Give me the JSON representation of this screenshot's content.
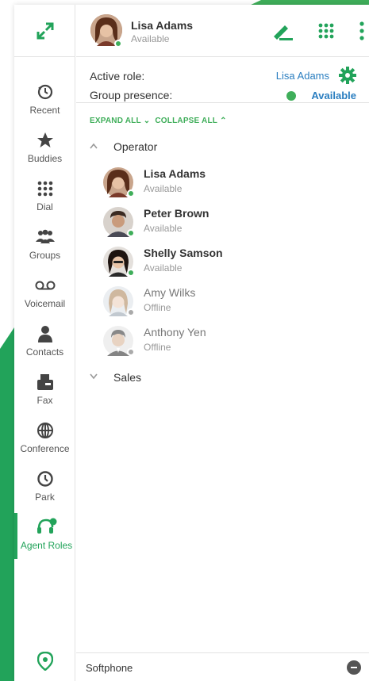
{
  "accent_color": "#22a35a",
  "header": {
    "user_name": "Lisa Adams",
    "user_status": "Available",
    "edit_icon": "pencil-icon",
    "dialpad_icon": "dialpad-icon",
    "menu_icon": "more-vertical-icon"
  },
  "sidebar": {
    "expand_icon": "expand-arrows-icon",
    "items": [
      {
        "label": "Recent",
        "icon": "history-icon"
      },
      {
        "label": "Buddies",
        "icon": "star-icon"
      },
      {
        "label": "Dial",
        "icon": "dialpad-icon"
      },
      {
        "label": "Groups",
        "icon": "group-icon"
      },
      {
        "label": "Voicemail",
        "icon": "voicemail-icon"
      },
      {
        "label": "Contacts",
        "icon": "person-icon"
      },
      {
        "label": "Fax",
        "icon": "fax-icon"
      },
      {
        "label": "Conference",
        "icon": "globe-icon"
      },
      {
        "label": "Park",
        "icon": "clock-icon"
      },
      {
        "label": "Agent Roles",
        "icon": "headset-icon",
        "active": true
      }
    ],
    "location_icon": "location-pin-icon"
  },
  "role": {
    "active_role_label": "Active role:",
    "active_role_value": "Lisa Adams",
    "group_presence_label": "Group presence:",
    "group_presence_value": "Available"
  },
  "expander": {
    "expand_all": "EXPAND ALL",
    "collapse_all": "COLLAPSE ALL"
  },
  "groups": [
    {
      "name": "Operator",
      "expanded": true,
      "agents": [
        {
          "name": "Lisa Adams",
          "status": "Available",
          "presence": "online"
        },
        {
          "name": "Peter Brown",
          "status": "Available",
          "presence": "online"
        },
        {
          "name": "Shelly Samson",
          "status": "Available",
          "presence": "online"
        },
        {
          "name": "Amy Wilks",
          "status": "Offline",
          "presence": "offline"
        },
        {
          "name": "Anthony Yen",
          "status": "Offline",
          "presence": "offline"
        }
      ]
    },
    {
      "name": "Sales",
      "expanded": false,
      "agents": []
    }
  ],
  "footer": {
    "label": "Softphone"
  }
}
